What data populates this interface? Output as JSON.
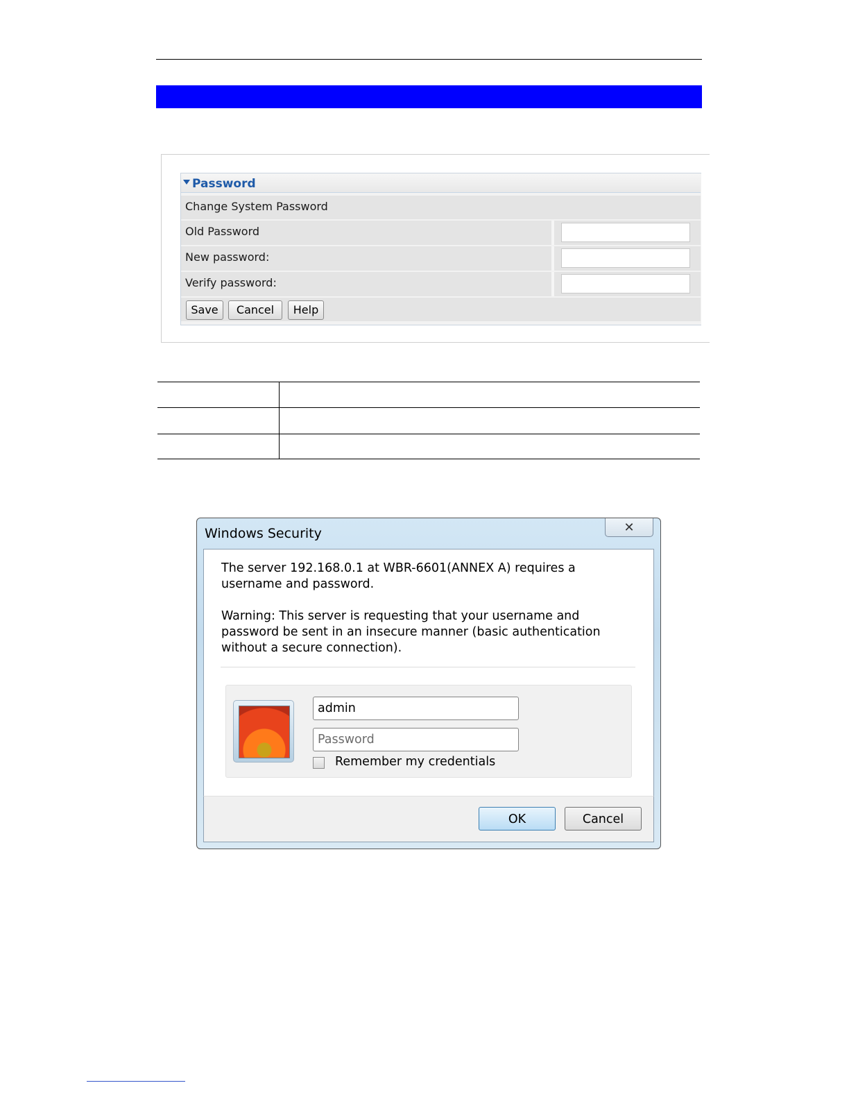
{
  "banner": {
    "color": "#0000ff"
  },
  "password_panel": {
    "title": "Password",
    "section_label": "Change System Password",
    "fields": [
      {
        "label": "Old Password",
        "value": ""
      },
      {
        "label": "New password:",
        "value": ""
      },
      {
        "label": "Verify password:",
        "value": ""
      }
    ],
    "buttons": {
      "save": "Save",
      "cancel": "Cancel",
      "help": "Help"
    }
  },
  "dialog": {
    "title": "Windows Security",
    "close_icon": "close-icon",
    "message": "The server 192.168.0.1 at WBR-6601(ANNEX A) requires a username and password.",
    "warning": "Warning: This server is requesting that your username and password be sent in an insecure manner (basic authentication without a secure connection).",
    "username_value": "admin",
    "password_placeholder": "Password",
    "remember_label": "Remember my credentials",
    "remember_checked": false,
    "ok_label": "OK",
    "cancel_label": "Cancel"
  }
}
